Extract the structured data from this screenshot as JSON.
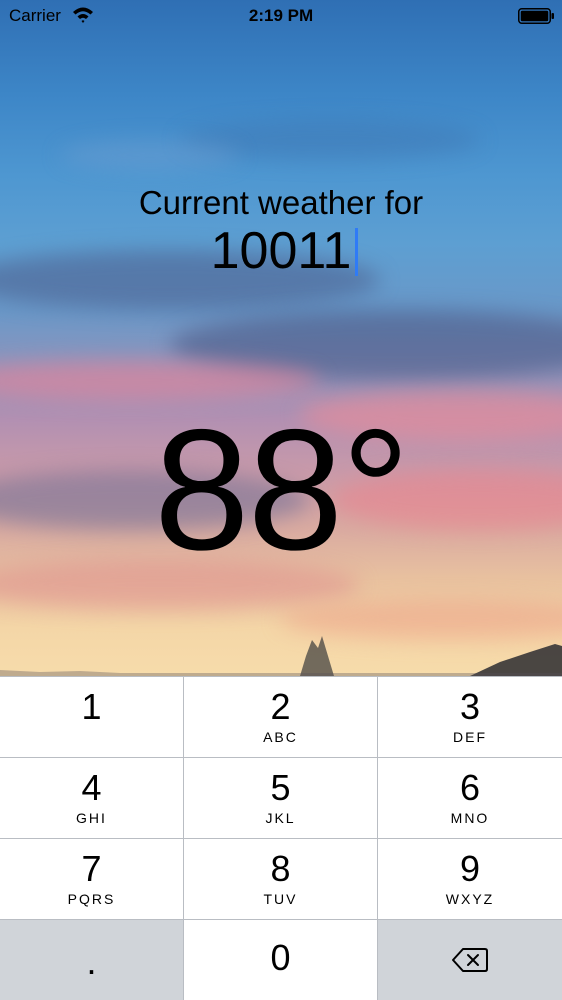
{
  "status_bar": {
    "carrier": "Carrier",
    "time": "2:19 PM",
    "wifi_icon": "wifi-icon",
    "battery_icon": "battery-icon"
  },
  "weather": {
    "label": "Current weather for",
    "zip": "10011",
    "temperature": "88°"
  },
  "keypad": {
    "keys": [
      {
        "digit": "1",
        "letters": ""
      },
      {
        "digit": "2",
        "letters": "ABC"
      },
      {
        "digit": "3",
        "letters": "DEF"
      },
      {
        "digit": "4",
        "letters": "GHI"
      },
      {
        "digit": "5",
        "letters": "JKL"
      },
      {
        "digit": "6",
        "letters": "MNO"
      },
      {
        "digit": "7",
        "letters": "PQRS"
      },
      {
        "digit": "8",
        "letters": "TUV"
      },
      {
        "digit": "9",
        "letters": "WXYZ"
      }
    ],
    "decimal": ".",
    "zero": "0",
    "delete_icon": "delete-backspace-icon"
  },
  "colors": {
    "caret": "#2f7bf6",
    "key_background": "#ffffff",
    "function_key_background": "#d0d4d9",
    "keypad_separator": "#b9bdc3"
  }
}
